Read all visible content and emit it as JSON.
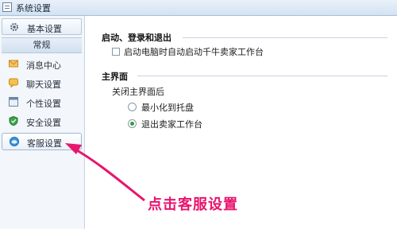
{
  "window": {
    "title": "系统设置"
  },
  "sidebar": {
    "top_item": "基本设置",
    "header": "常规",
    "items": [
      {
        "label": "消息中心",
        "icon": "envelope-icon"
      },
      {
        "label": "聊天设置",
        "icon": "chat-bubble-icon"
      },
      {
        "label": "个性设置",
        "icon": "window-icon"
      },
      {
        "label": "安全设置",
        "icon": "shield-icon"
      },
      {
        "label": "客服设置",
        "icon": "customer-service-icon",
        "selected": true
      }
    ]
  },
  "main": {
    "startup": {
      "title": "启动、登录和退出",
      "checkbox_label": "启动电脑时自动启动千牛卖家工作台",
      "checked": false
    },
    "mainui": {
      "title": "主界面",
      "close_label": "关闭主界面后",
      "options": [
        {
          "label": "最小化到托盘",
          "selected": false
        },
        {
          "label": "退出卖家工作台",
          "selected": true
        }
      ]
    }
  },
  "annotation": {
    "text": "点击客服设置",
    "color": "#e8146d"
  }
}
